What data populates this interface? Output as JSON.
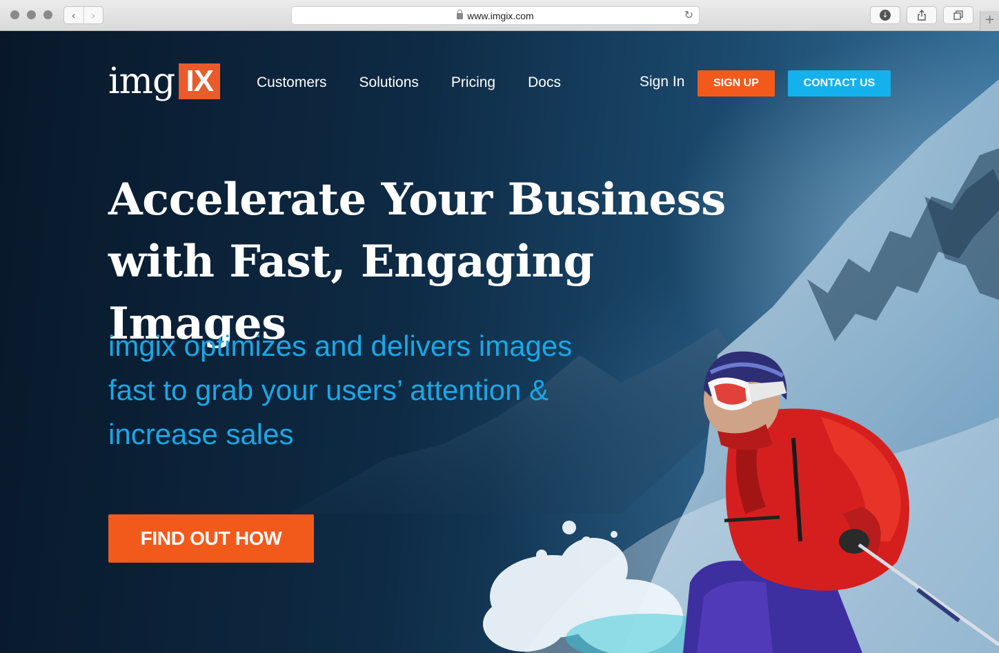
{
  "browser": {
    "url": "www.imgix.com",
    "back_icon": "chevron-left-icon",
    "forward_icon": "chevron-right-icon",
    "reload_icon": "reload-icon",
    "download_icon": "download-icon",
    "share_icon": "share-icon",
    "tabs_icon": "tabs-icon",
    "new_tab_icon": "plus-icon"
  },
  "header": {
    "logo_text": "img",
    "logo_box": "IX",
    "nav": [
      "Customers",
      "Solutions",
      "Pricing",
      "Docs"
    ],
    "sign_in": "Sign In",
    "sign_up": "SIGN UP",
    "contact": "CONTACT US"
  },
  "hero": {
    "headline_line1": "Accelerate Your Business",
    "headline_line2": "with Fast, Engaging Images",
    "sub_line1": "imgix optimizes and delivers images",
    "sub_line2": "fast to grab your users’ attention &",
    "sub_line3": "increase sales",
    "cta": "FIND OUT HOW"
  },
  "colors": {
    "accent_orange": "#f25a1c",
    "accent_blue": "#15b1ec",
    "subline_blue": "#19a8e6",
    "logo_orange": "#ea5a2a"
  }
}
